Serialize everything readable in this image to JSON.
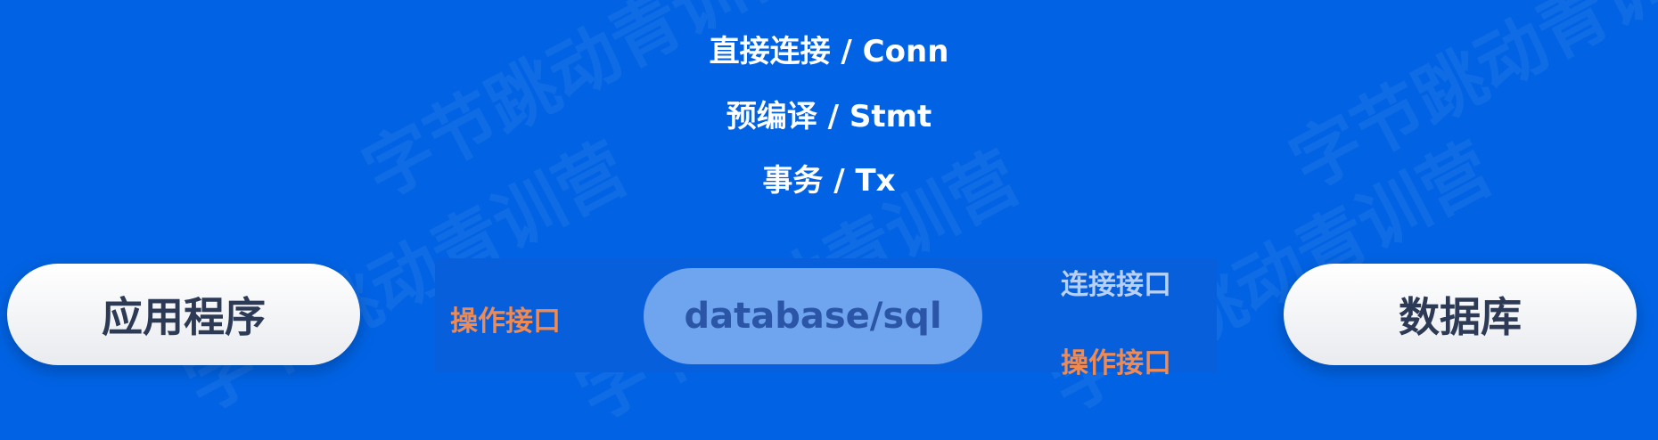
{
  "apis": [
    {
      "label": "直接连接 / Conn"
    },
    {
      "label": "预编译 / Stmt"
    },
    {
      "label": "事务 / Tx"
    }
  ],
  "nodes": {
    "application": "应用程序",
    "package": "database/sql",
    "database": "数据库"
  },
  "interfaces": {
    "app_side": "操作接口",
    "db_connect": "连接接口",
    "db_operate": "操作接口"
  },
  "watermark": "字节跳动青训营",
  "colors": {
    "background": "#0163e4",
    "accent_orange": "#ee8a52",
    "pill_blue": "#6fa4ee",
    "node_text": "#2d3a55"
  }
}
